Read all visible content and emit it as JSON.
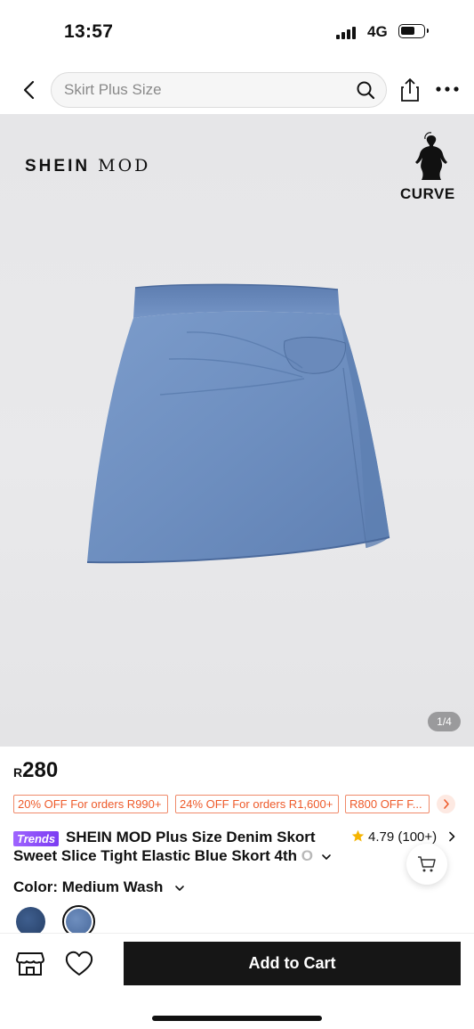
{
  "status_bar": {
    "time": "13:57",
    "network": "4G"
  },
  "search": {
    "placeholder": "Skirt Plus Size"
  },
  "hero": {
    "brand_logo_bold": "SHEIN",
    "brand_logo_serif": "MOD",
    "curve_label": "CURVE",
    "image_counter": "1/4"
  },
  "product": {
    "currency": "R",
    "price": "280",
    "coupons": [
      "20% OFF For orders R990+",
      "24% OFF For orders R1,600+",
      "R800 OFF F..."
    ],
    "trends_badge": "Trends",
    "title_line1": "SHEIN MOD Plus Size Denim Skort",
    "title_line2": "Sweet Slice Tight Elastic Blue Skort 4th",
    "title_fade": " O",
    "rating": "4.79",
    "rating_count": "(100+)",
    "color_label": "Color:",
    "color_value": "Medium Wash",
    "swatches": [
      "dark-wash",
      "medium-wash"
    ]
  },
  "bottom_bar": {
    "add_to_cart": "Add to Cart"
  },
  "colors": {
    "accent_coupon": "#ee5a2a",
    "trends_purple": "#8a4cf7",
    "button_dark": "#161616",
    "star": "#f5b400"
  }
}
